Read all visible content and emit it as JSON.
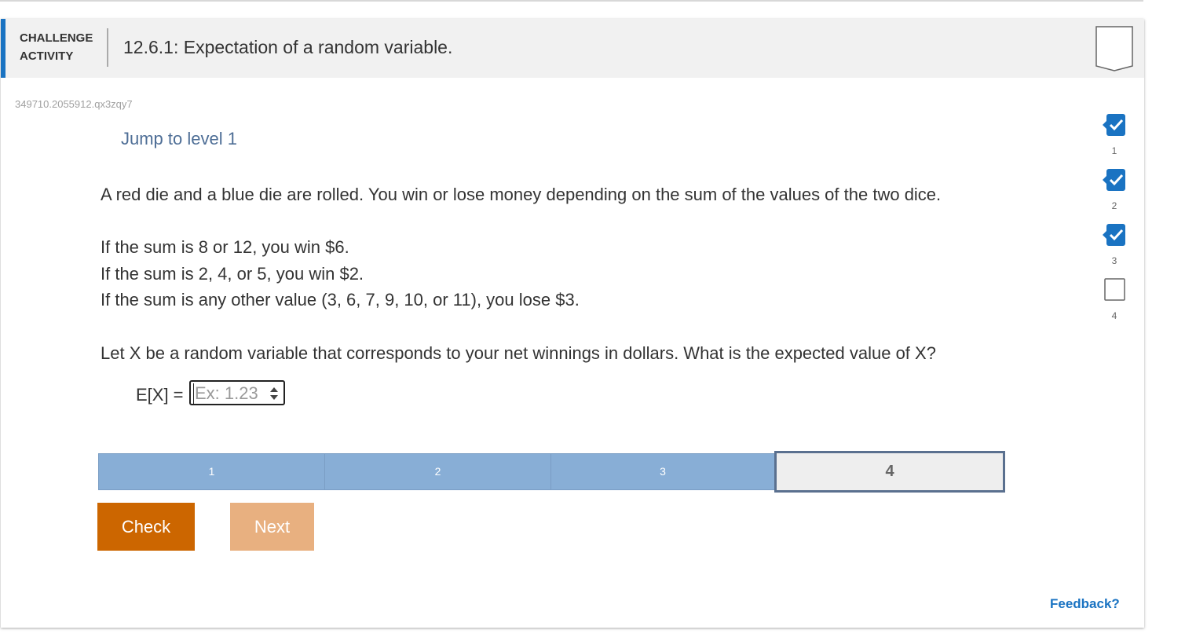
{
  "header": {
    "activity_type": "CHALLENGE ACTIVITY",
    "title": "12.6.1: Expectation of a random variable."
  },
  "activity_id": "349710.2055912.qx3zqy7",
  "jump_link": "Jump to level 1",
  "prompt": {
    "intro": "A red die and a blue die are rolled. You win or lose money depending on the sum of the values of the two dice.",
    "rules": [
      "If the sum is 8 or 12, you win $6.",
      "If the sum is 2, 4, or 5, you win $2.",
      "If the sum is any other value (3, 6, 7, 9, 10, or 11), you lose $3."
    ],
    "question": "Let X be a random variable that corresponds to your net winnings in dollars. What is the expected value of X?"
  },
  "answer": {
    "label": "E[X] =",
    "placeholder": "Ex: 1.23",
    "value": ""
  },
  "levels": [
    {
      "label": "1",
      "state": "completed"
    },
    {
      "label": "2",
      "state": "completed"
    },
    {
      "label": "3",
      "state": "completed"
    },
    {
      "label": "4",
      "state": "current"
    }
  ],
  "buttons": {
    "check": "Check",
    "next": "Next"
  },
  "progress_steps": [
    {
      "number": "1",
      "completed": true
    },
    {
      "number": "2",
      "completed": true
    },
    {
      "number": "3",
      "completed": true
    },
    {
      "number": "4",
      "completed": false
    }
  ],
  "feedback_link": "Feedback?",
  "colors": {
    "accent_blue": "#1a73c2",
    "check_button": "#cc6600",
    "next_button_disabled": "#e8b080",
    "level_completed": "#88aed6",
    "level_current_border": "#5a708f",
    "jump_link": "#4e6e96"
  }
}
